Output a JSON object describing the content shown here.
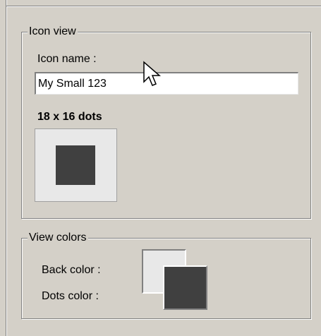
{
  "icon_view": {
    "group_title": "Icon view",
    "name_label": "Icon name :",
    "name_value": "My Small 123",
    "dots_heading": "18 x 16 dots",
    "preview": {
      "back_color": "#e8e8e8",
      "dots_color": "#404040"
    }
  },
  "view_colors": {
    "group_title": "View colors",
    "back_color_label": "Back color :",
    "dots_color_label": "Dots color :",
    "back_color": "#e8e8e8",
    "dots_color": "#404040"
  },
  "theme": {
    "panel_bg": "#d4d0c8",
    "shadow": "#808080",
    "highlight": "#ffffff"
  },
  "cursor": {
    "icon": "arrow-pointer-icon"
  }
}
